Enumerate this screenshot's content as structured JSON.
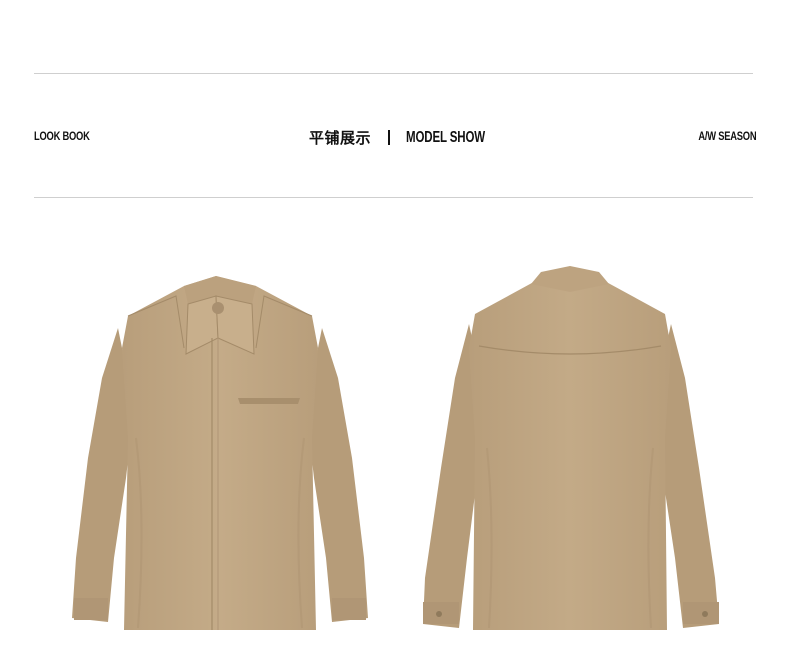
{
  "header": {
    "left_label": "LOOK BOOK",
    "title_cn": "平铺展示",
    "title_en": "MODEL SHOW",
    "right_label": "A/W SEASON"
  },
  "product": {
    "color_hex": "#c2a986",
    "shade_hex": "#a89070",
    "views": [
      "front-view",
      "back-view"
    ]
  }
}
